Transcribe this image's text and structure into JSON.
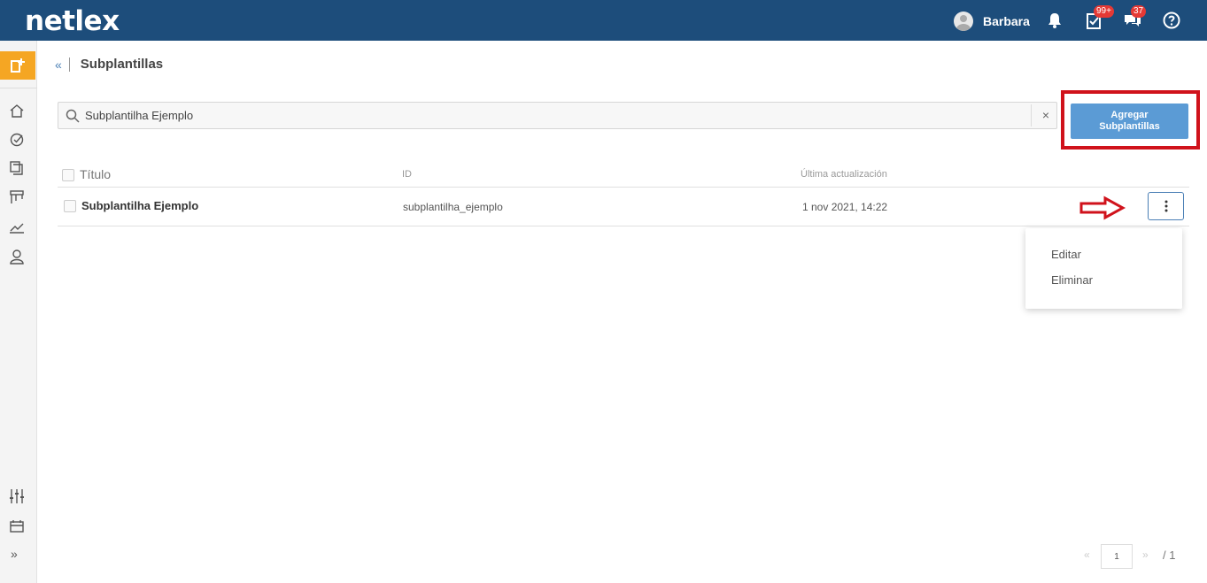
{
  "app": {
    "logo": "netlex"
  },
  "header": {
    "user_name": "Barbara",
    "tasks_badge": "99+",
    "messages_badge": "37"
  },
  "breadcrumb": {
    "back": "«",
    "title": "Subplantillas"
  },
  "search": {
    "value": "Subplantilha Ejemplo",
    "clear": "×"
  },
  "add_button": {
    "label_line1": "Agregar",
    "label_line2": "Subplantillas"
  },
  "table": {
    "headers": {
      "title": "Título",
      "id": "ID",
      "updated": "Última actualización"
    },
    "rows": [
      {
        "title": "Subplantilha Ejemplo",
        "id": "subplantilha_ejemplo",
        "updated": "1 nov 2021, 14:22"
      }
    ]
  },
  "row_menu": {
    "items": [
      "Editar",
      "Eliminar"
    ]
  },
  "pagination": {
    "prev": "«",
    "current": "1",
    "next": "»",
    "total": "/ 1"
  },
  "colors": {
    "header_bg": "#1d4d7b",
    "accent": "#5b9bd5",
    "highlight": "#d0121b",
    "add_orange": "#f5a623"
  },
  "sidebar": {
    "icons": [
      "home-icon",
      "tasks-icon",
      "documents-icon",
      "board-icon",
      "reports-icon",
      "user-icon",
      "settings-sliders-icon",
      "calendar-icon",
      "expand-icon"
    ]
  }
}
